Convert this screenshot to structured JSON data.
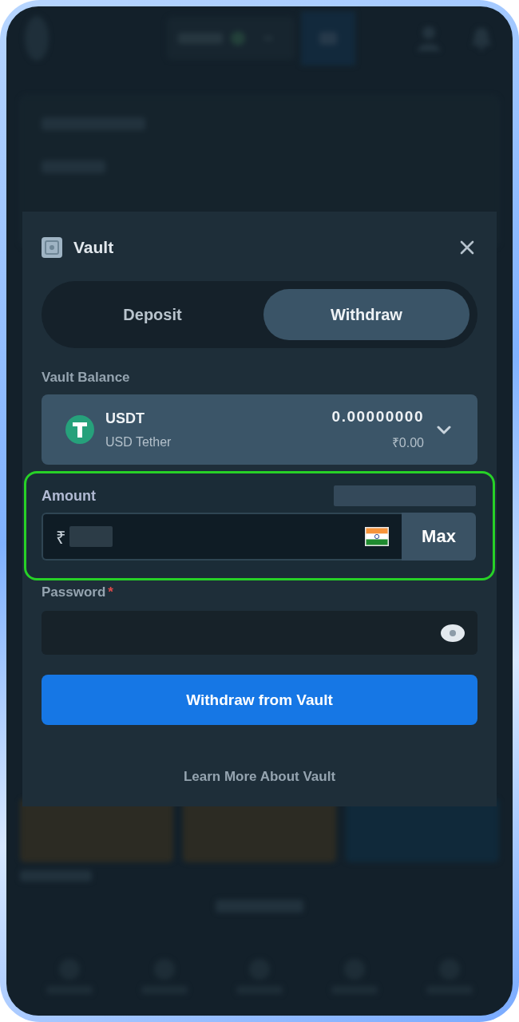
{
  "modal": {
    "title": "Vault"
  },
  "tabs": [
    {
      "label": "Deposit",
      "selected": false
    },
    {
      "label": "Withdraw",
      "selected": true
    }
  ],
  "vault_balance": {
    "label": "Vault Balance",
    "coin": {
      "code": "USDT",
      "name": "USD Tether",
      "amount": "0.00000000",
      "fiat": "₹0.00"
    }
  },
  "amount": {
    "label": "Amount",
    "label_side_redacted": true,
    "symbol": "₹",
    "value_redacted": true,
    "max_button": "Max",
    "highlighted": true
  },
  "password": {
    "label": "Password",
    "required_mark": "*"
  },
  "submit_button": "Withdraw from Vault",
  "learn_more_link": "Learn More About Vault"
}
